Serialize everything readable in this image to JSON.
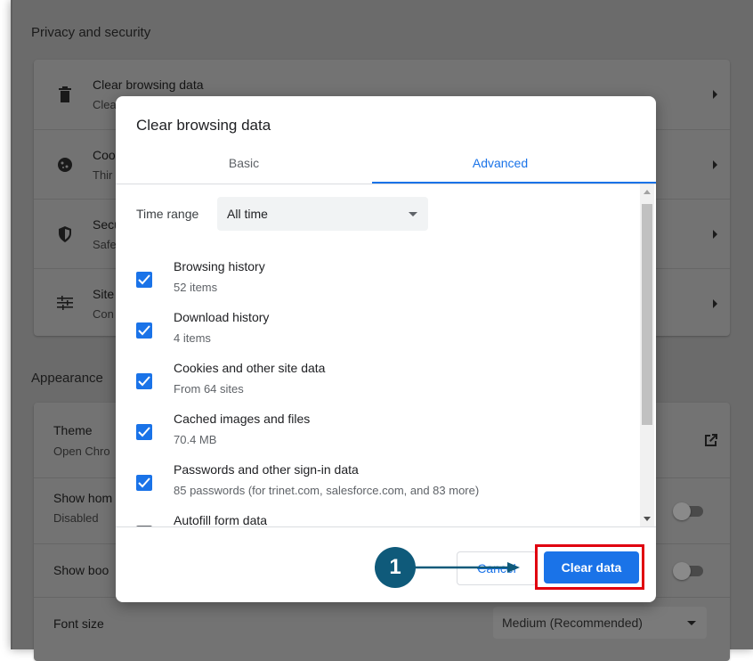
{
  "settings": {
    "privacy_section_title": "Privacy and security",
    "privacy_rows": [
      {
        "title": "Clear browsing data",
        "subtitle": "Clea",
        "icon": "trash-icon"
      },
      {
        "title": "Coo",
        "subtitle": "Thir",
        "icon": "cookie-icon"
      },
      {
        "title": "Secu",
        "subtitle": "Safe",
        "icon": "shield-icon"
      },
      {
        "title": "Site",
        "subtitle": "Con",
        "icon": "sliders-icon"
      }
    ],
    "appearance_section_title": "Appearance",
    "appearance_rows": [
      {
        "title": "Theme",
        "subtitle": "Open Chro"
      },
      {
        "title": "Show hom",
        "subtitle": "Disabled"
      },
      {
        "title": "Show boo",
        "subtitle": ""
      },
      {
        "title": "Font size",
        "subtitle": ""
      }
    ],
    "font_size_value": "Medium (Recommended)"
  },
  "dialog": {
    "title": "Clear browsing data",
    "tabs": [
      {
        "label": "Basic",
        "active": false
      },
      {
        "label": "Advanced",
        "active": true
      }
    ],
    "time_range_label": "Time range",
    "time_range_value": "All time",
    "items": [
      {
        "title": "Browsing history",
        "subtitle": "52 items",
        "checked": true
      },
      {
        "title": "Download history",
        "subtitle": "4 items",
        "checked": true
      },
      {
        "title": "Cookies and other site data",
        "subtitle": "From 64 sites",
        "checked": true
      },
      {
        "title": "Cached images and files",
        "subtitle": "70.4 MB",
        "checked": true
      },
      {
        "title": "Passwords and other sign-in data",
        "subtitle": "85 passwords (for trinet.com, salesforce.com, and 83 more)",
        "checked": true
      },
      {
        "title": "Autofill form data",
        "subtitle": "",
        "checked": false
      }
    ],
    "cancel_label": "Cancel",
    "clear_label": "Clear data"
  },
  "annotation": {
    "step_number": "1"
  },
  "colors": {
    "accent": "#1a73e8",
    "highlight": "#e0000f",
    "step_badge": "#0f5a7a"
  }
}
